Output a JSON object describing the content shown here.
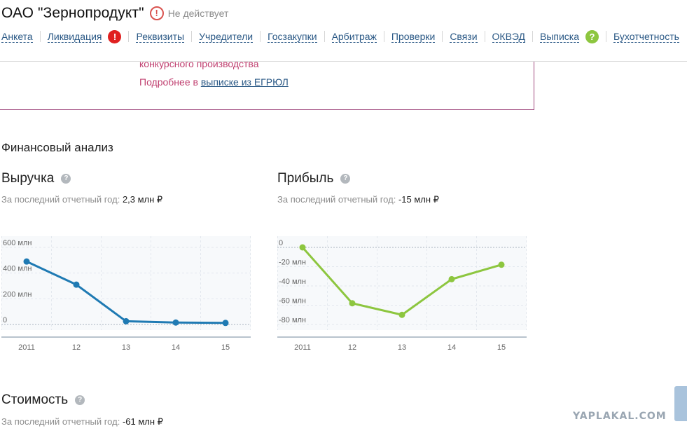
{
  "header": {
    "company_name": "ОАО \"Зернопродукт\"",
    "status_icon": "!",
    "status_text": "Не действует"
  },
  "tabs": [
    {
      "label": "Анкета"
    },
    {
      "label": "Ликвидация",
      "badge": "!"
    },
    {
      "label": "Реквизиты"
    },
    {
      "label": "Учредители"
    },
    {
      "label": "Госзакупки"
    },
    {
      "label": "Арбитраж"
    },
    {
      "label": "Проверки"
    },
    {
      "label": "Связи"
    },
    {
      "label": "ОКВЭД"
    },
    {
      "label": "Выписка",
      "badge": "?"
    },
    {
      "label": "Бухотчетность"
    }
  ],
  "notice": {
    "line1": "конкурсного производства",
    "more_prefix": "Подробнее в ",
    "more_link": "выписке из ЕГРЮЛ"
  },
  "section_title": "Финансовый анализ",
  "help_icon": "?",
  "revenue": {
    "title": "Выручка",
    "subtitle_label": "За последний отчетный год: ",
    "subtitle_value": "2,3 млн ₽"
  },
  "profit": {
    "title": "Прибыль",
    "subtitle_label": "За последний отчетный год: ",
    "subtitle_value": "-15 млн ₽"
  },
  "value_section": {
    "title": "Стоимость",
    "subtitle_label": "За последний отчетный год: ",
    "subtitle_value": "-61 млн ₽"
  },
  "watermark": "YAPLAKAL.COM",
  "chart_data": [
    {
      "type": "line",
      "categories": [
        "2011",
        "12",
        "13",
        "14",
        "15"
      ],
      "values": [
        490,
        310,
        25,
        15,
        12
      ],
      "ylim": [
        0,
        600
      ],
      "yticks": [
        "0",
        "200 млн",
        "400 млн",
        "600 млн"
      ],
      "color": "#1f7ab3",
      "grid": true
    },
    {
      "type": "line",
      "categories": [
        "2011",
        "12",
        "13",
        "14",
        "15"
      ],
      "values": [
        0,
        -58,
        -70,
        -33,
        -18
      ],
      "ylim": [
        -80,
        0
      ],
      "yticks": [
        "0",
        "-20 млн",
        "-40 млн",
        "-60 млн",
        "-80 млн"
      ],
      "color": "#8dc63f",
      "grid": true
    }
  ]
}
